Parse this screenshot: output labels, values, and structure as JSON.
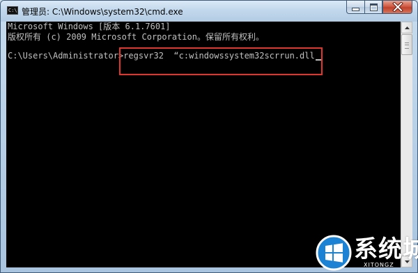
{
  "window": {
    "title": "管理员: C:\\Windows\\system32\\cmd.exe",
    "icon_text": "C:\\"
  },
  "console": {
    "line1": "Microsoft Windows [版本 6.1.7601]",
    "line2": "版权所有 (c) 2009 Microsoft Corporation。保留所有权利。",
    "prompt": "C:\\Users\\Administrator>",
    "command": "regsvr32  “c:windowssystem32scrrun.dll"
  },
  "icons": {
    "title_icon": "cmd-icon",
    "minimize": "minimize-icon",
    "maximize": "maximize-icon",
    "close": "close-icon",
    "scroll_up": "arrow-up-icon",
    "scroll_down": "arrow-down-icon",
    "watermark_logo": "windows-logo-icon"
  },
  "colors": {
    "console_bg": "#000000",
    "console_text": "#c0c0c0",
    "highlight": "#e2352c"
  },
  "watermark": {
    "text": "系统城",
    "subtext": "XITONGZ"
  }
}
